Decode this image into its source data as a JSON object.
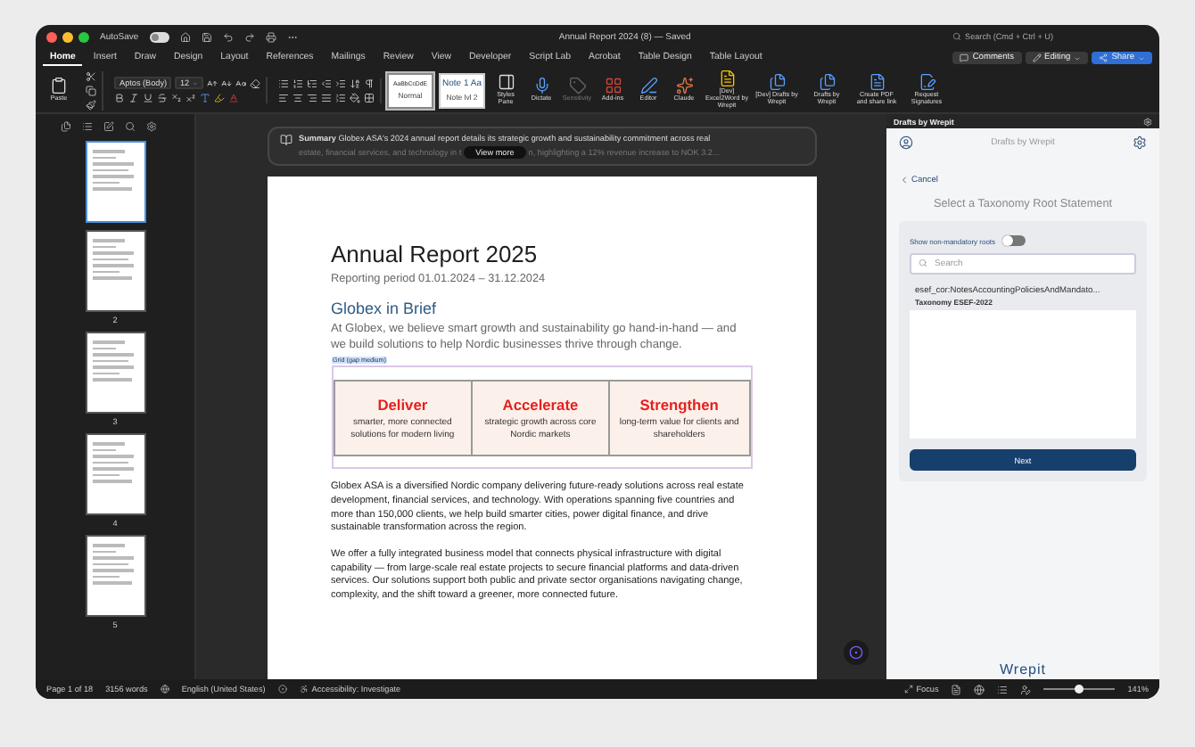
{
  "window": {
    "title": "Annual Report 2024 (8) — Saved",
    "autosave": {
      "label": "AutoSave",
      "on": false
    },
    "search_placeholder": "Search (Cmd + Ctrl + U)"
  },
  "menu_tabs": [
    {
      "label": "Home",
      "selected": true
    },
    {
      "label": "Insert",
      "selected": false
    },
    {
      "label": "Draw",
      "selected": false
    },
    {
      "label": "Design",
      "selected": false
    },
    {
      "label": "Layout",
      "selected": false
    },
    {
      "label": "References",
      "selected": false
    },
    {
      "label": "Mailings",
      "selected": false
    },
    {
      "label": "Review",
      "selected": false
    },
    {
      "label": "View",
      "selected": false
    },
    {
      "label": "Developer",
      "selected": false
    },
    {
      "label": "Script Lab",
      "selected": false
    },
    {
      "label": "Acrobat",
      "selected": false
    },
    {
      "label": "Table Design",
      "selected": false
    },
    {
      "label": "Table Layout",
      "selected": false
    }
  ],
  "header_buttons": [
    {
      "kind": "comments",
      "label": "Comments"
    },
    {
      "kind": "editing",
      "label": "Editing"
    },
    {
      "kind": "share",
      "label": "Share"
    }
  ],
  "ribbon": {
    "paste_label": "Paste",
    "font": "Aptos (Body)",
    "font_size": "12",
    "styles": [
      {
        "preview": "AaBbCcDdE",
        "name": "Normal",
        "selected": true
      },
      {
        "preview": "Note 1 Aa",
        "name": "Note lvl 2",
        "selected": false
      }
    ],
    "commands": [
      {
        "kind": "styles",
        "label": "Styles Pane",
        "disabled": false
      },
      {
        "kind": "dictate",
        "label": "Dictate",
        "disabled": false
      },
      {
        "kind": "sensitivity",
        "label": "Sensitivity",
        "disabled": true
      },
      {
        "kind": "addins",
        "label": "Add-ins",
        "disabled": false
      },
      {
        "kind": "editor",
        "label": "Editor",
        "disabled": false
      },
      {
        "kind": "claude",
        "label": "Claude",
        "disabled": false
      },
      {
        "kind": "excel2word",
        "label": "[Dev] Excel2Word by Wrepit",
        "disabled": false
      },
      {
        "kind": "drafts",
        "label": "[Dev] Drafts by Wrepit",
        "disabled": false
      },
      {
        "kind": "drafts",
        "label": "Drafts by Wrepit",
        "disabled": false
      },
      {
        "kind": "pdf",
        "label": "Create PDF and share link",
        "disabled": false
      },
      {
        "kind": "sign",
        "label": "Request Signatures",
        "disabled": false
      }
    ]
  },
  "summary": {
    "text": "**Summary** Globex ASA's 2024 annual report details its strategic growth and sustainability commitment across real",
    "detail_before": "estate, financial services, and technology in t",
    "button": "View more",
    "detail_after": "n, highlighting a 12% revenue increase to NOK 3.2..."
  },
  "thumbnails": [
    {
      "selected": true
    },
    {
      "number": "2",
      "selected": false
    },
    {
      "number": "3",
      "selected": false
    },
    {
      "number": "4",
      "selected": false
    },
    {
      "number": "5",
      "selected": false
    }
  ],
  "document": {
    "title": "Annual Report 2025",
    "subtitle": "Reporting period 01.01.2024 – 31.12.2024",
    "heading": "Globex in Brief",
    "intro": "At Globex, we believe smart growth and sustainability go hand-in-hand — and we build solutions to help Nordic businesses thrive through change.",
    "grid_tag": "Grid (gap medium)",
    "cards": [
      {
        "title": "Deliver",
        "text": "smarter, more connected solutions for modern living"
      },
      {
        "title": "Accelerate",
        "text": "strategic growth across core Nordic markets"
      },
      {
        "title": "Strengthen",
        "text": "long-term value for clients and shareholders"
      }
    ],
    "paragraphs": [
      "Globex ASA is a diversified Nordic company delivering future-ready solutions across real estate development, financial services, and technology. With operations spanning five countries and more than 150,000 clients, we help build smarter cities, power digital finance, and drive sustainable transformation across the region.",
      "We offer a fully integrated business model that connects physical infrastructure with digital capability — from large-scale real estate projects to secure financial platforms and data-driven services. Our solutions support both public and private sector organisations navigating change, complexity, and the shift toward a greener, more connected future."
    ]
  },
  "pane": {
    "header": "Drafts by Wrepit",
    "title": "Drafts by Wrepit",
    "cancel": "Cancel",
    "heading": "Select a Taxonomy Root Statement",
    "toggle": {
      "label": "Show non-mandatory roots",
      "on": false
    },
    "search_placeholder": "Search",
    "results": [
      {
        "name": "esef_cor:NotesAccountingPoliciesAndMandato...",
        "taxonomy": "Taxonomy ESEF-2022",
        "selected": false
      }
    ],
    "next": "Next",
    "logo": "Wrepit"
  },
  "status_bar": {
    "page": "Page 1 of 18",
    "words": "3156 words",
    "language": "English (United States)",
    "accessibility": "Accessibility: Investigate",
    "focus": "Focus",
    "zoom_slider": {
      "level": 0.5
    },
    "zoom": "141%"
  }
}
